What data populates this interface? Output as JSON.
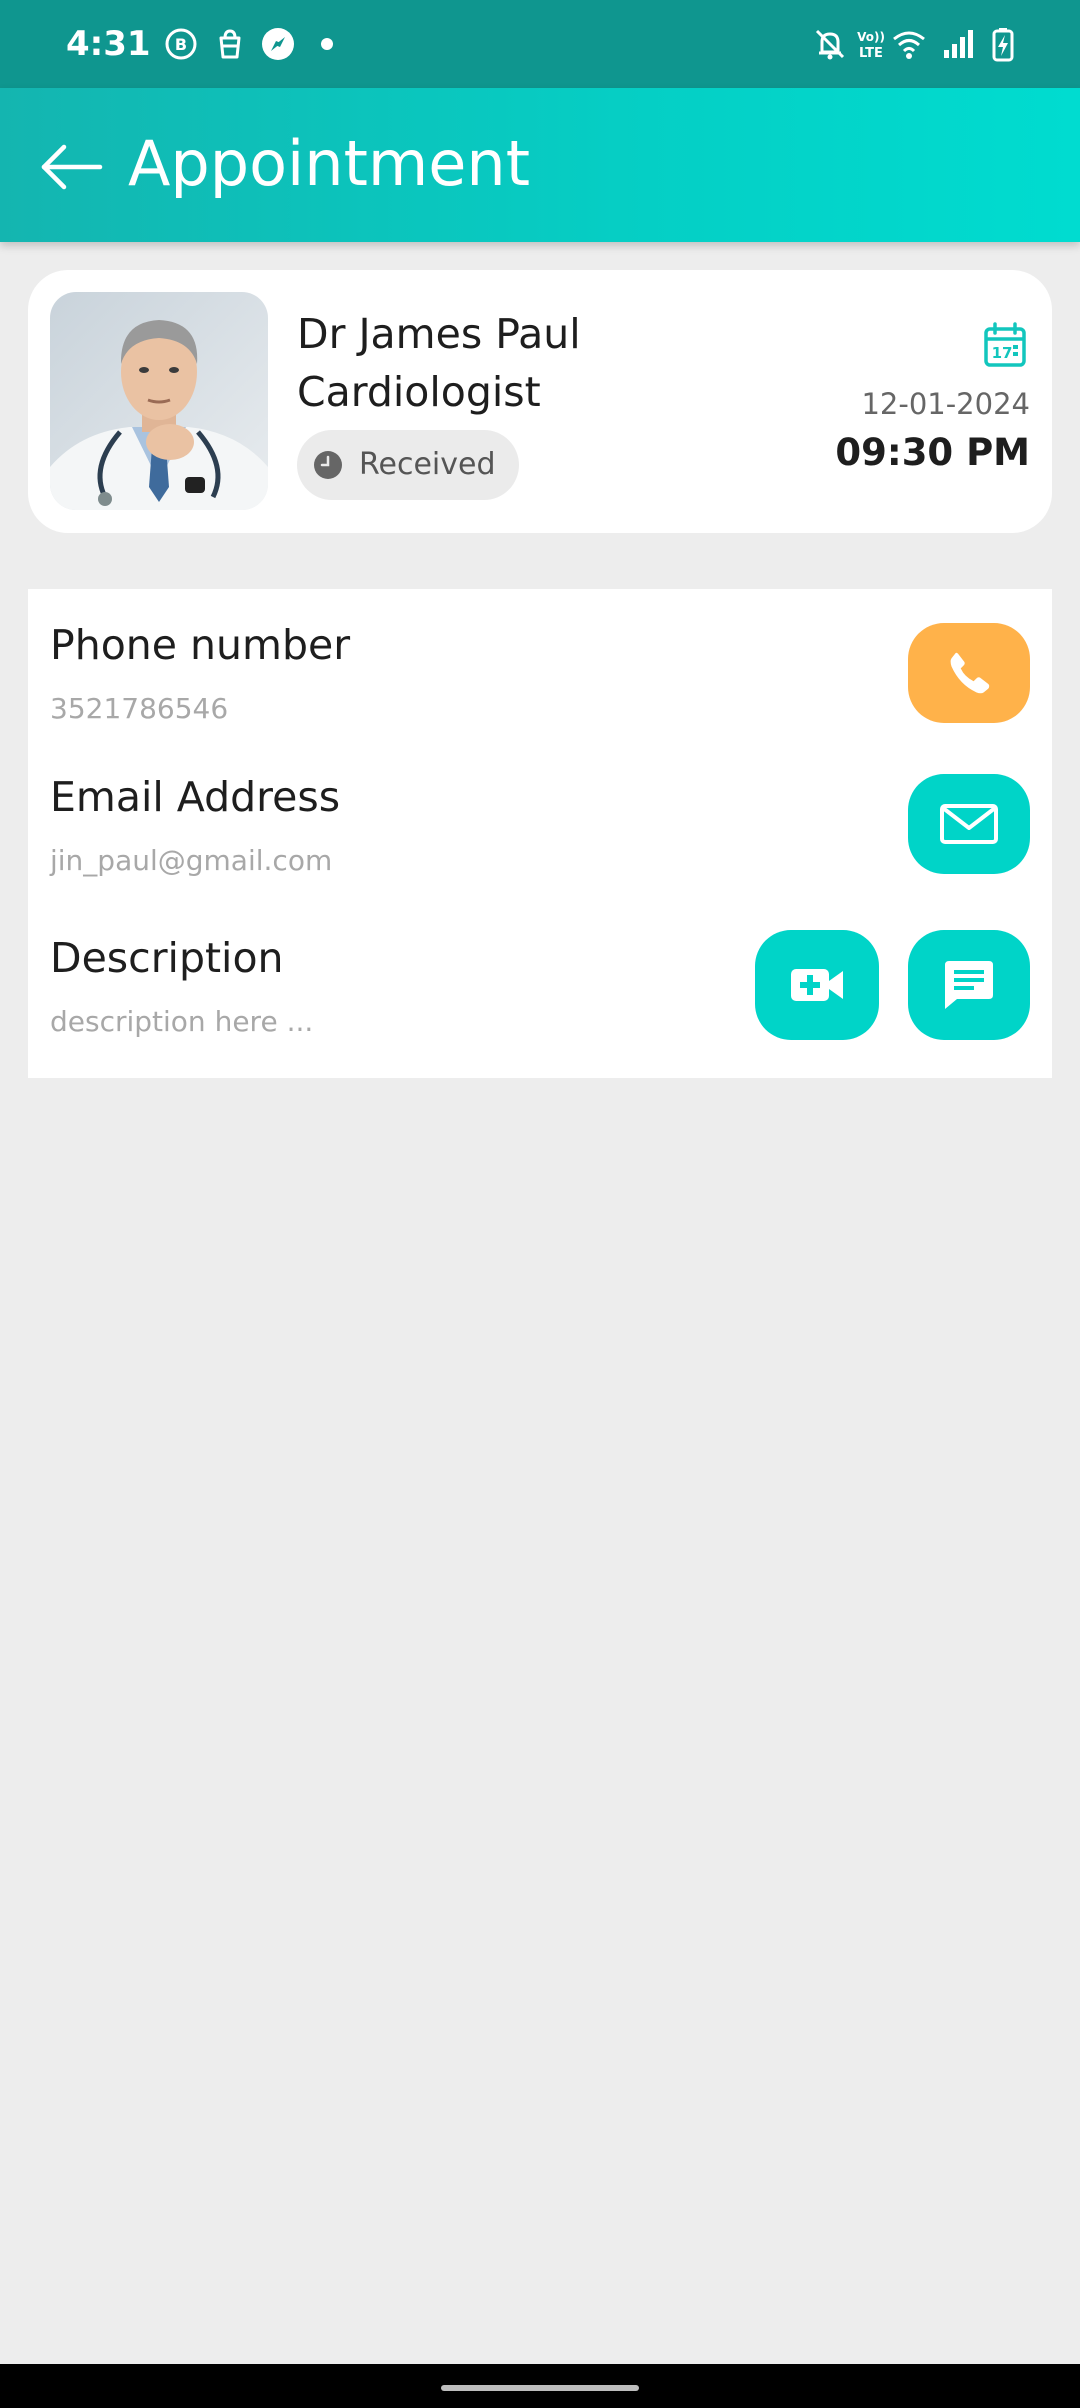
{
  "status_bar": {
    "time": "4:31",
    "left_icons": [
      "b-circle-icon",
      "shopping-bag-icon",
      "compass-icon",
      "dot-icon"
    ],
    "right_icons": [
      "bell-off-icon",
      "volte-icon",
      "wifi-icon",
      "signal-icon",
      "battery-charging-icon"
    ]
  },
  "app_bar": {
    "title": "Appointment",
    "back_icon": "arrow-left-icon"
  },
  "appointment": {
    "doctor_name": "Dr James Paul",
    "specialty": "Cardiologist",
    "status": "Received",
    "date": "12-01-2024",
    "time": "09:30 PM",
    "calendar_day": "17"
  },
  "contact": {
    "phone_label": "Phone number",
    "phone_value": "3521786546",
    "email_label": "Email Address",
    "email_value": "jin_paul@gmail.com",
    "description_label": "Description",
    "description_placeholder": "description here ..."
  },
  "colors": {
    "primary": "#00d4c8",
    "status_bar": "#0f968f",
    "call_button": "#ffb24a",
    "background": "#ededed"
  }
}
